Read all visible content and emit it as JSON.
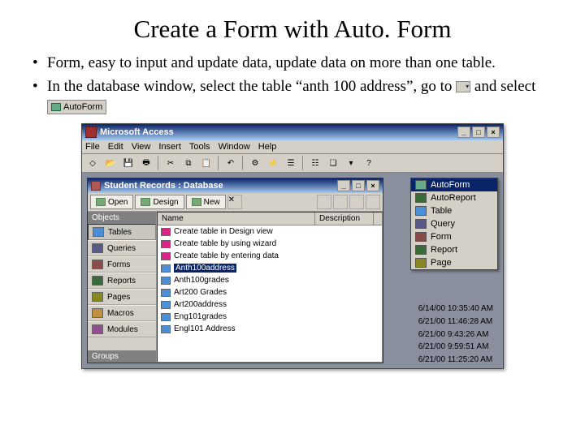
{
  "title": "Create a Form with Auto. Form",
  "bullets": [
    "Form, easy to input and update data, update data on more than one table.",
    {
      "pre": "In the database window, select the table “anth 100 address”, go to",
      "mid": "and select",
      "autoform_label": "AutoForm"
    }
  ],
  "app": {
    "title": "Microsoft Access",
    "menu": [
      "File",
      "Edit",
      "View",
      "Insert",
      "Tools",
      "Window",
      "Help"
    ],
    "db_title": "Student Records : Database",
    "db_toolbar": {
      "open": "Open",
      "design": "Design",
      "new": "New"
    },
    "sidebar_header": "Objects",
    "sidebar": [
      "Tables",
      "Queries",
      "Forms",
      "Reports",
      "Pages",
      "Macros",
      "Modules"
    ],
    "sidebar_footer": "Groups",
    "list_headers": {
      "name": "Name",
      "desc": "Description"
    },
    "rows": [
      {
        "label": "Create table in Design view",
        "kind": "wizard"
      },
      {
        "label": "Create table by using wizard",
        "kind": "wizard"
      },
      {
        "label": "Create table by entering data",
        "kind": "wizard"
      },
      {
        "label": "Anth100address",
        "kind": "tbl",
        "selected": true
      },
      {
        "label": "Anth100grades",
        "kind": "tbl"
      },
      {
        "label": "Art200 Grades",
        "kind": "tbl"
      },
      {
        "label": "Art200address",
        "kind": "tbl"
      },
      {
        "label": "Eng101grades",
        "kind": "tbl"
      },
      {
        "label": "Engl101 Address",
        "kind": "tbl"
      }
    ],
    "dropdown": [
      {
        "label": "AutoForm",
        "icon": "af",
        "hover": true
      },
      {
        "label": "AutoReport",
        "icon": "ar"
      },
      {
        "label": "Table",
        "icon": "tb"
      },
      {
        "label": "Query",
        "icon": "qr"
      },
      {
        "label": "Form",
        "icon": "fm"
      },
      {
        "label": "Report",
        "icon": "rp"
      },
      {
        "label": "Page",
        "icon": "pg"
      }
    ],
    "dates_suffix": "AM",
    "dates": [
      "6/14/00 10:35:40 AM",
      "6/21/00 11:46:28 AM",
      "6/21/00 9:43:26 AM",
      "6/21/00 9:59:51 AM",
      "6/21/00 11:25:20 AM"
    ]
  }
}
